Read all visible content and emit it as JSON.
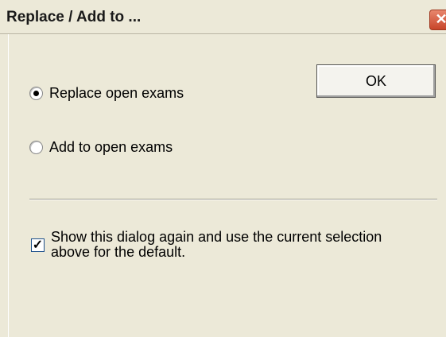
{
  "window": {
    "title": "Replace / Add to ...",
    "close_glyph": "✕"
  },
  "buttons": {
    "ok_label": "OK"
  },
  "options": [
    {
      "label": "Replace open exams",
      "selected": true
    },
    {
      "label": "Add to open exams",
      "selected": false
    }
  ],
  "checkbox": {
    "label": "Show this dialog again and use the current selection above for the default.",
    "checked": true,
    "glyph": "✓"
  }
}
